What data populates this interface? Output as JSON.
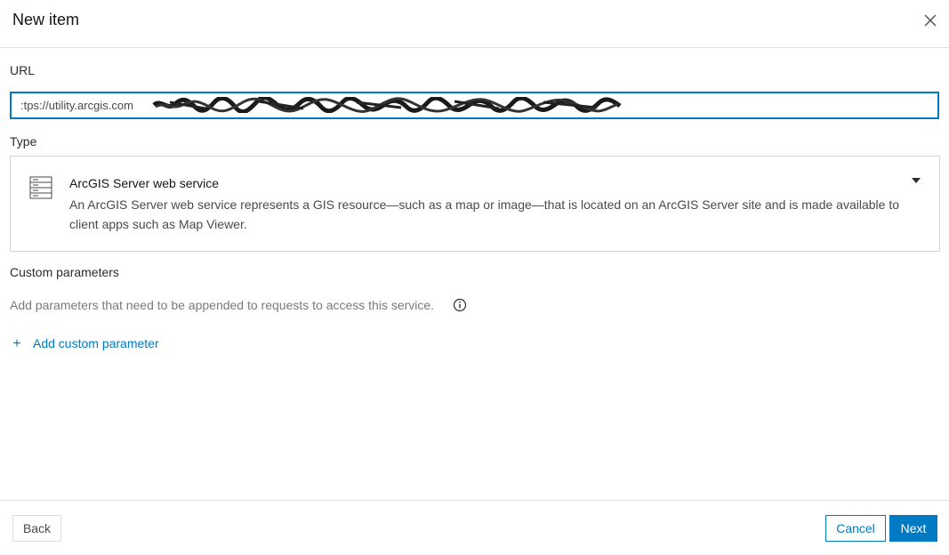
{
  "dialog": {
    "title": "New item"
  },
  "url": {
    "label": "URL",
    "value": ":tps://utility.arcgis.com"
  },
  "type": {
    "label": "Type",
    "selected_title": "ArcGIS Server web service",
    "selected_description": "An ArcGIS Server web service represents a GIS resource—such as a map or image—that is located on an ArcGIS Server site and is made available to client apps such as Map Viewer.",
    "icon": "server-icon"
  },
  "custom_params": {
    "label": "Custom parameters",
    "hint": "Add parameters that need to be appended to requests to access this service.",
    "add_label": "Add custom parameter"
  },
  "footer": {
    "back_label": "Back",
    "cancel_label": "Cancel",
    "next_label": "Next"
  },
  "colors": {
    "accent": "#007ac2",
    "border": "#d4d4d4"
  }
}
